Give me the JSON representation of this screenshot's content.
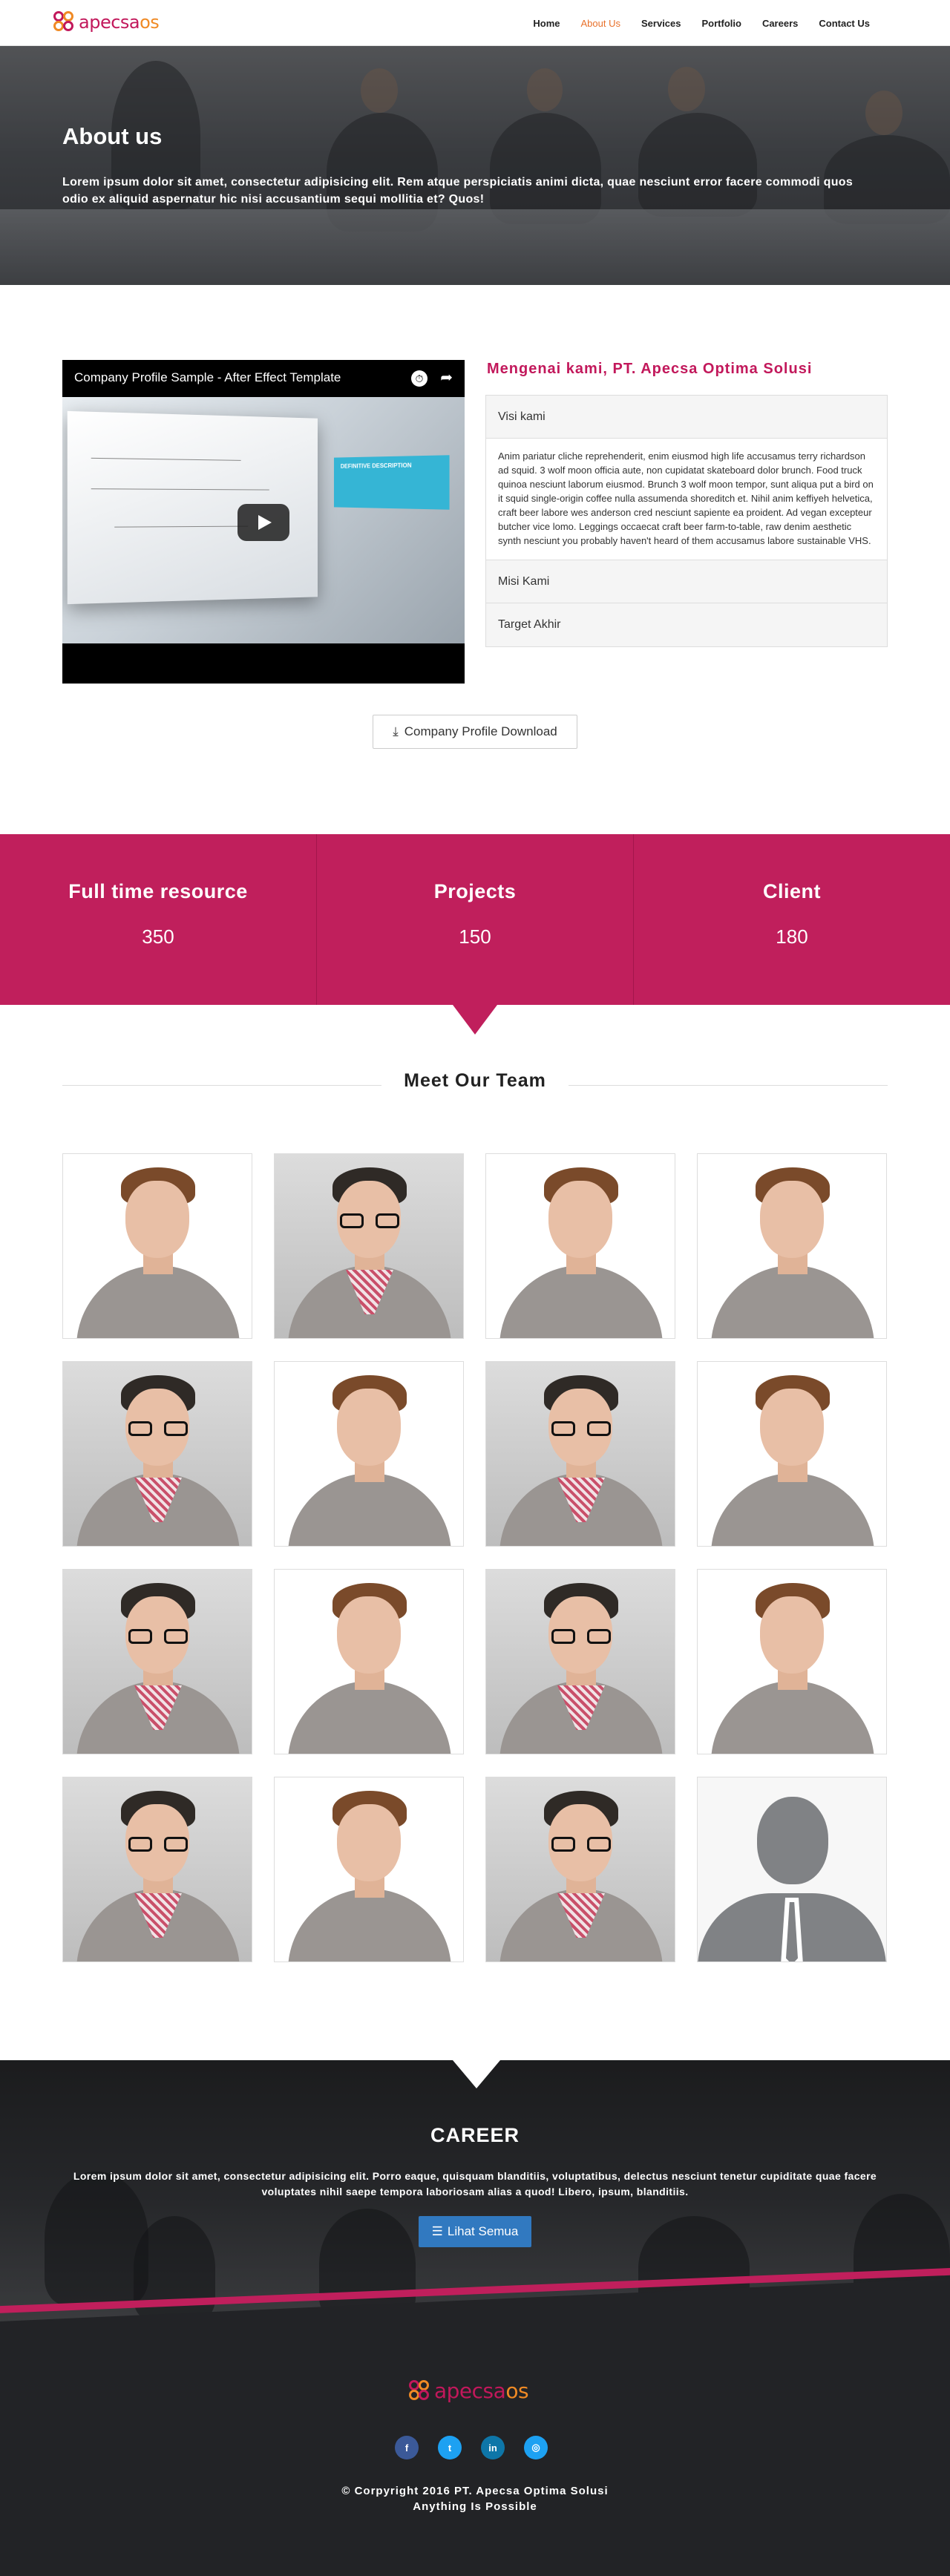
{
  "brand": {
    "logo_part1": "apecsa",
    "logo_part2": "os",
    "primary_color": "#c01f5c",
    "accent_color": "#f08a24",
    "icon": "flower-logo-icon"
  },
  "nav": {
    "items": [
      {
        "label": "Home"
      },
      {
        "label": "About Us",
        "active": true
      },
      {
        "label": "Services"
      },
      {
        "label": "Portfolio"
      },
      {
        "label": "Careers"
      },
      {
        "label": "Contact Us"
      }
    ]
  },
  "hero": {
    "title": "About us",
    "text": "Lorem ipsum dolor sit amet, consectetur adipisicing elit. Rem atque perspiciatis animi dicta, quae nesciunt error facere commodi quos odio ex aliquid aspernatur hic nisi accusantium sequi mollitia et? Quos!"
  },
  "video": {
    "title": "Company Profile Sample - After Effect Template",
    "screen_label": "DEFINITIVE DESCRIPTION",
    "icons": [
      "clock-icon",
      "share-icon",
      "play-icon"
    ]
  },
  "about": {
    "title": "Mengenai kami, PT. Apecsa Optima Solusi",
    "accordion": [
      {
        "label": "Visi kami",
        "open": true,
        "body": "Anim pariatur cliche reprehenderit, enim eiusmod high life accusamus terry richardson ad squid. 3 wolf moon officia aute, non cupidatat skateboard dolor brunch. Food truck quinoa nesciunt laborum eiusmod. Brunch 3 wolf moon tempor, sunt aliqua put a bird on it squid single-origin coffee nulla assumenda shoreditch et. Nihil anim keffiyeh helvetica, craft beer labore wes anderson cred nesciunt sapiente ea proident. Ad vegan excepteur butcher vice lomo. Leggings occaecat craft beer farm-to-table, raw denim aesthetic synth nesciunt you probably haven't heard of them accusamus labore sustainable VHS."
      },
      {
        "label": "Misi Kami",
        "open": false
      },
      {
        "label": "Target Akhir",
        "open": false
      }
    ],
    "download_label": "Company Profile Download",
    "download_icon": "download-icon"
  },
  "stats": [
    {
      "label": "Full time resource",
      "value": "350"
    },
    {
      "label": "Projects",
      "value": "150"
    },
    {
      "label": "Client",
      "value": "180"
    }
  ],
  "team": {
    "title": "Meet Our Team",
    "members": [
      "smiling-man",
      "glasses-man",
      "smiling-man",
      "smiling-man",
      "glasses-man",
      "smiling-man",
      "glasses-man",
      "smiling-man",
      "glasses-man",
      "smiling-man",
      "glasses-man",
      "smiling-man",
      "glasses-man",
      "smiling-man",
      "glasses-man",
      "silhouette"
    ]
  },
  "career": {
    "title": "CAREER",
    "text": "Lorem ipsum dolor sit amet, consectetur adipisicing elit. Porro eaque, quisquam blanditiis, voluptatibus, delectus nesciunt tenetur cupiditate quae facere voluptates nihil saepe tempora laboriosam alias a quod! Libero, ipsum, blanditiis.",
    "button_label": "Lihat Semua",
    "button_icon": "list-icon",
    "button_color": "#3179c0"
  },
  "footer": {
    "socials": [
      {
        "name": "facebook-icon",
        "glyph": "f",
        "color": "#3b5998"
      },
      {
        "name": "twitter-icon",
        "glyph": "t",
        "color": "#1da1f2"
      },
      {
        "name": "linkedin-icon",
        "glyph": "in",
        "color": "#0e76a8"
      },
      {
        "name": "instagram-icon",
        "glyph": "◎",
        "color": "#1da1f2"
      }
    ],
    "copyright": "© Corpyright 2016 PT. Apecsa Optima Solusi",
    "tagline": "Anything Is Possible"
  }
}
